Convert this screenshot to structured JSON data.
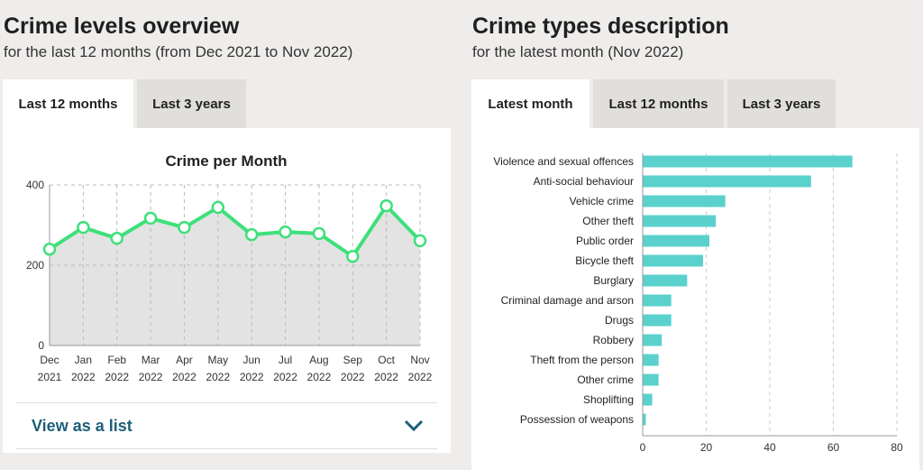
{
  "left": {
    "title": "Crime levels overview",
    "subtitle": "for the last 12 months (from Dec 2021 to Nov 2022)",
    "tabs": [
      {
        "label": "Last 12 months",
        "active": true
      },
      {
        "label": "Last 3 years",
        "active": false
      }
    ],
    "list_toggle": "View as a list"
  },
  "right": {
    "title": "Crime types description",
    "subtitle": "for the latest month (Nov 2022)",
    "tabs": [
      {
        "label": "Latest month",
        "active": true
      },
      {
        "label": "Last 12 months",
        "active": false
      },
      {
        "label": "Last 3 years",
        "active": false
      }
    ]
  },
  "chart_data": [
    {
      "type": "area",
      "title": "Crime per Month",
      "categories": [
        [
          "Dec",
          "2021"
        ],
        [
          "Jan",
          "2022"
        ],
        [
          "Feb",
          "2022"
        ],
        [
          "Mar",
          "2022"
        ],
        [
          "Apr",
          "2022"
        ],
        [
          "May",
          "2022"
        ],
        [
          "Jun",
          "2022"
        ],
        [
          "Jul",
          "2022"
        ],
        [
          "Aug",
          "2022"
        ],
        [
          "Sep",
          "2022"
        ],
        [
          "Oct",
          "2022"
        ],
        [
          "Nov",
          "2022"
        ]
      ],
      "values": [
        240,
        294,
        267,
        317,
        294,
        344,
        276,
        283,
        279,
        222,
        348,
        261
      ],
      "ylim": [
        0,
        400
      ],
      "yticks": [
        0,
        200,
        400
      ],
      "grid": true,
      "line_color": "#3ee07a",
      "fill_color": "#e3e3e3"
    },
    {
      "type": "bar",
      "orientation": "horizontal",
      "categories": [
        "Violence and sexual offences",
        "Anti-social behaviour",
        "Vehicle crime",
        "Other theft",
        "Public order",
        "Bicycle theft",
        "Burglary",
        "Criminal damage and arson",
        "Drugs",
        "Robbery",
        "Theft from the person",
        "Other crime",
        "Shoplifting",
        "Possession of weapons"
      ],
      "values": [
        66,
        53,
        26,
        23,
        21,
        19,
        14,
        9,
        9,
        6,
        5,
        5,
        3,
        1
      ],
      "xlim": [
        0,
        80
      ],
      "xticks": [
        0,
        20,
        40,
        60,
        80
      ],
      "grid": true,
      "bar_color": "#5ad1cc"
    }
  ]
}
